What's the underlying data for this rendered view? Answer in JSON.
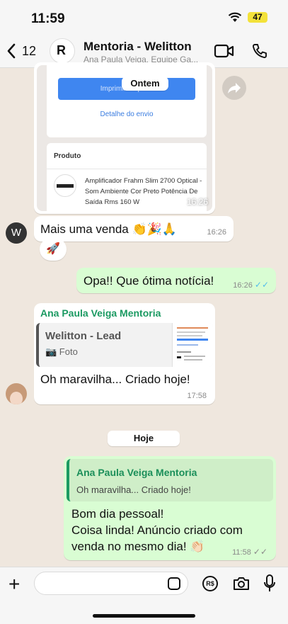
{
  "status_bar": {
    "time": "11:59",
    "battery": "47"
  },
  "header": {
    "back_count": "12",
    "title": "Mentoria - Welitton",
    "subtitle": "Ana Paula Veiga, Equipe Ga...",
    "avatar_letter": "R"
  },
  "messages": {
    "image_msg": {
      "print_button": "Imprimir etiqueta",
      "detail_link": "Detalhe do envio",
      "product_label": "Produto",
      "product_name": "Amplificador Frahm Slim 2700 Optical - Som Ambiente Cor Preto Potência De Saída Rms 160 W",
      "time": "16:26"
    },
    "date_ontem": "Ontem",
    "msg_venda": {
      "avatar_letter": "W",
      "text": "Mais uma venda 👏🎉🙏",
      "time": "16:26",
      "reaction": "🚀"
    },
    "msg_opa": {
      "text": "Opa!! Que ótima notícia!",
      "time": "16:26",
      "ticks": "✓✓"
    },
    "msg_criado": {
      "sender": "Ana Paula Veiga Mentoria",
      "quote_author": "Welitton - Lead",
      "quote_type": "📷 Foto",
      "text": "Oh maravilha... Criado hoje!",
      "time": "17:58"
    },
    "date_hoje": "Hoje",
    "msg_bomdia": {
      "quote_author": "Ana Paula Veiga Mentoria",
      "quote_text": "Oh maravilha... Criado hoje!",
      "line1": "Bom dia pessoal!",
      "line2": "Coisa linda! Anúncio criado com",
      "line3": "venda no mesmo dia! 👏🏻",
      "time": "11:58",
      "ticks": "✓✓"
    }
  },
  "composer": {
    "pay_label": "R$"
  },
  "colors": {
    "accent_green": "#1b9a62",
    "read_ticks": "#53bdeb",
    "out_bubble": "#d9fdd3",
    "chat_bg": "#efe7de"
  }
}
